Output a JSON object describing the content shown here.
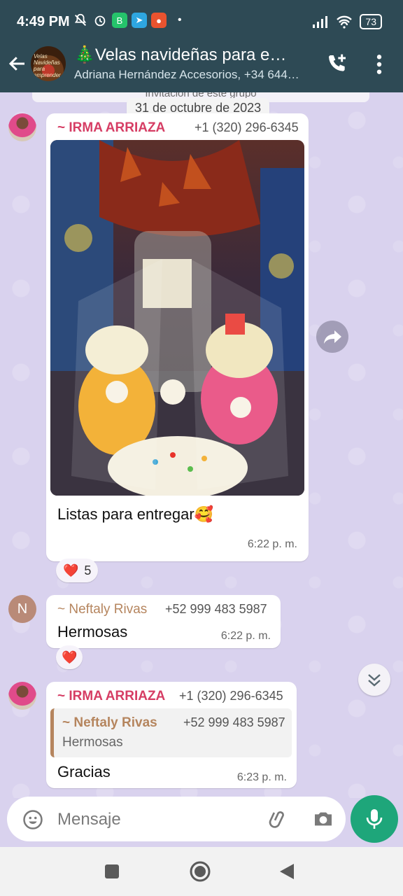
{
  "status_bar": {
    "time": "4:49 PM",
    "battery": "73",
    "icons_left": [
      "mute-icon",
      "alarm-icon",
      "whatsapp-business-icon",
      "telegram-icon",
      "app-icon"
    ],
    "icons_right": [
      "signal-icon",
      "wifi-icon",
      "battery-icon"
    ]
  },
  "header": {
    "title": "🎄Velas navideñas para e…",
    "subtitle": "Adriana Hernández Accesorios, +34 644…",
    "avatar_text": "Velas Navideñas para emprender"
  },
  "chat": {
    "system_message": "Invitación de este grupo",
    "date_label": "31 de octubre de 2023",
    "messages": [
      {
        "sender": "~ IRMA ARRIAZA",
        "phone": "+1 (320) 296-6345",
        "text": "Listas para entregar🥰",
        "time": "6:22 p. m.",
        "image": "photo of three gift-wrapped candles",
        "reaction": {
          "emoji": "❤️",
          "count": "5"
        }
      },
      {
        "sender": "~ Neftaly Rivas",
        "phone": "+52 999 483 5987",
        "text": "Hermosas",
        "time": "6:22 p. m.",
        "avatar_letter": "N",
        "reaction": {
          "emoji": "❤️"
        }
      },
      {
        "sender": "~ IRMA ARRIAZA",
        "phone": "+1 (320) 296-6345",
        "text": "Gracias",
        "time": "6:23 p. m.",
        "quote": {
          "sender": "~ Neftaly Rivas",
          "phone": "+52 999 483 5987",
          "text": "Hermosas"
        }
      }
    ]
  },
  "input": {
    "placeholder": "Mensaje"
  },
  "colors": {
    "header_bg": "#2e4a55",
    "chat_bg": "#d9d2ee",
    "accent_green": "#1ea67a",
    "irma_name": "#d63d64",
    "neftaly_name": "#b5855e"
  }
}
